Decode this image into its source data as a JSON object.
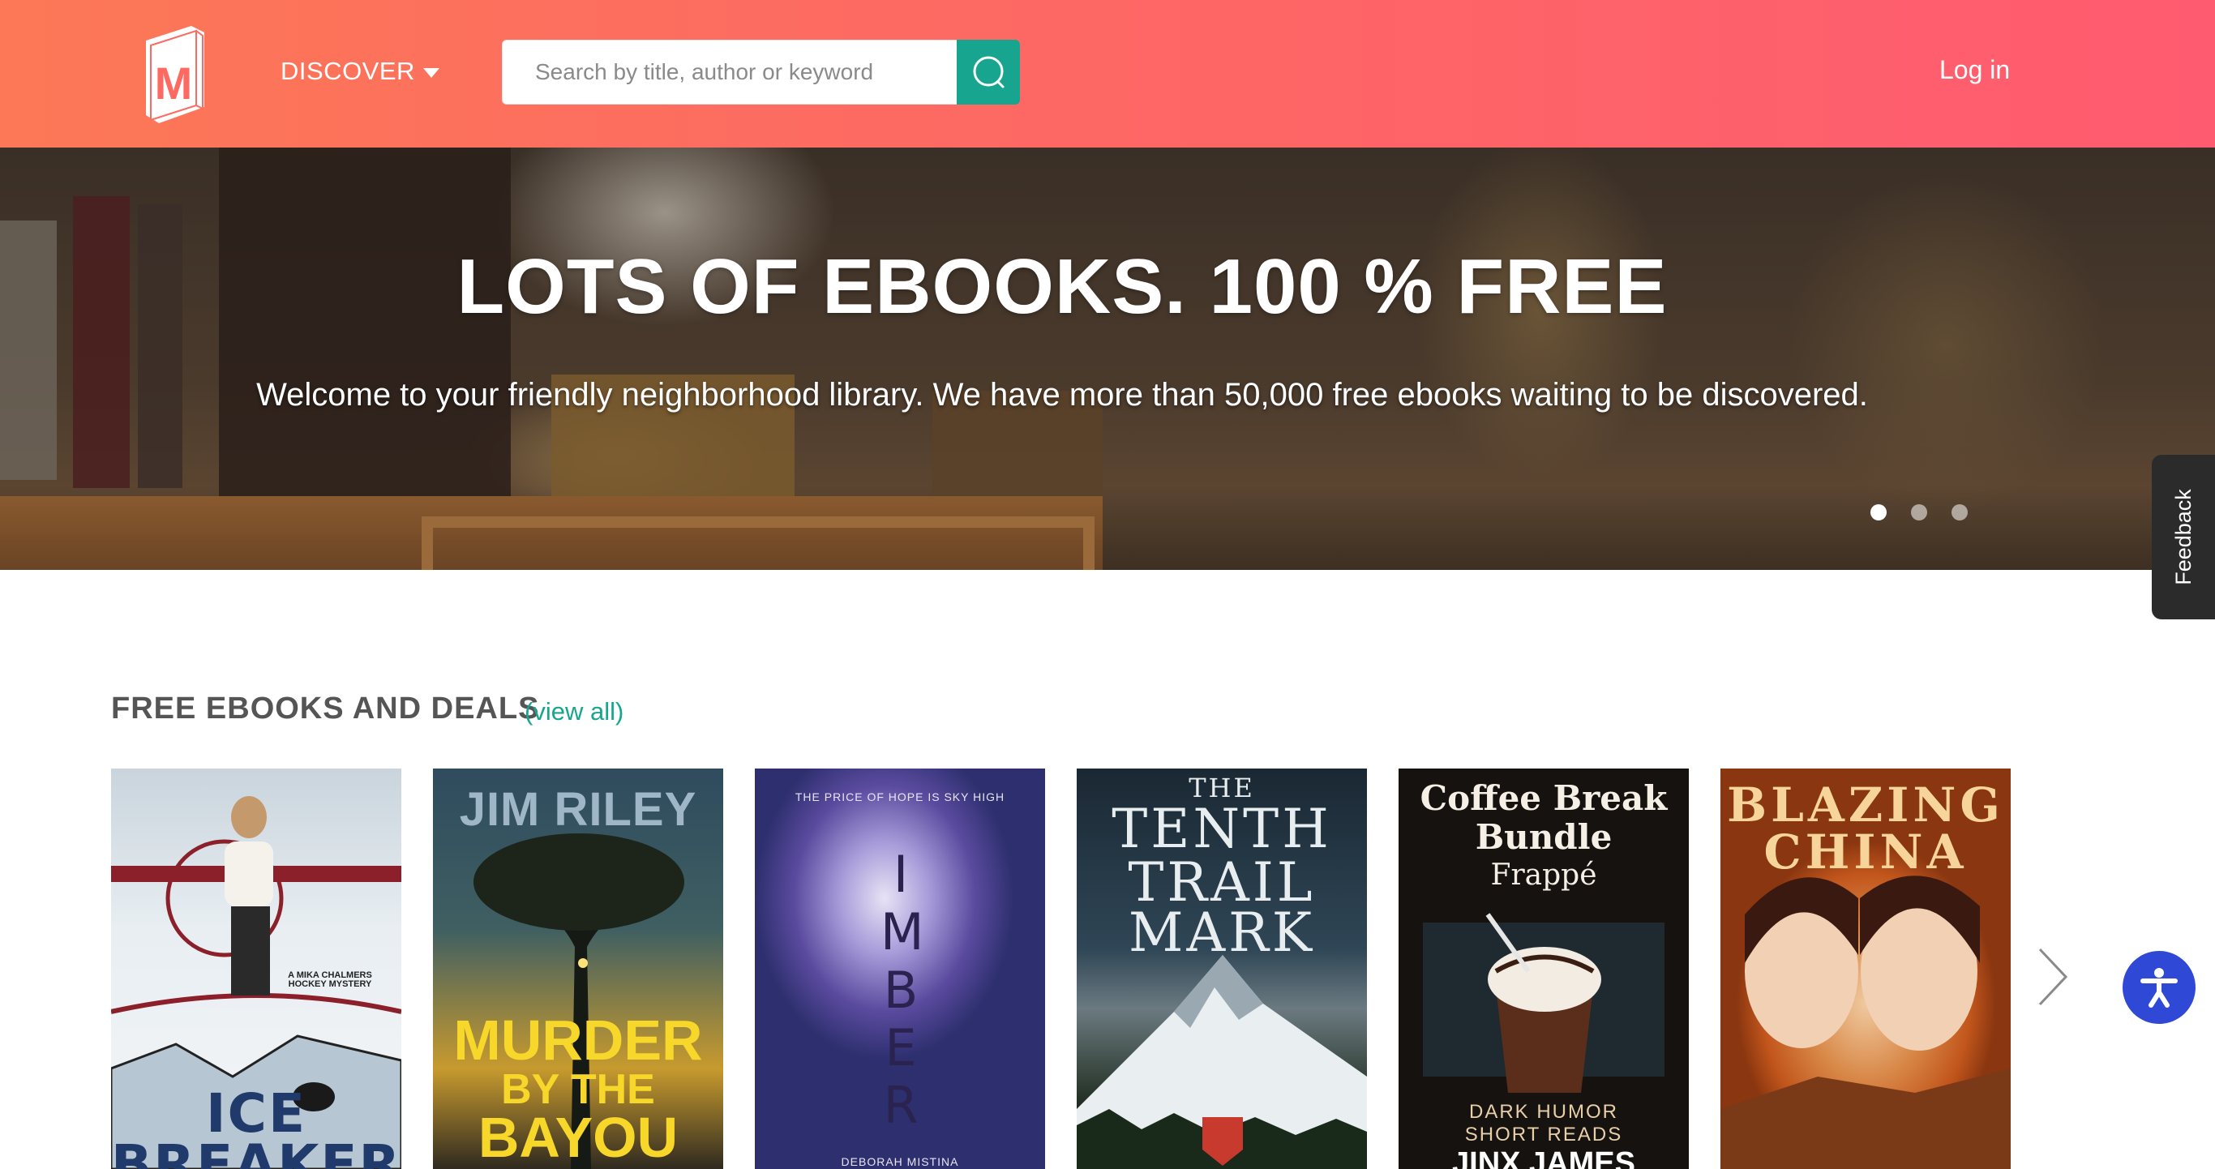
{
  "header": {
    "logo_icon": "book-logo-icon",
    "logo_letter": "M",
    "discover_label": "DISCOVER",
    "search_placeholder": "Search by title, author or keyword",
    "search_icon": "search-icon",
    "login_label": "Log in"
  },
  "hero": {
    "title": "LOTS OF EBOOKS. 100 % FREE",
    "subtitle": "Welcome to your friendly neighborhood library. We have more than 50,000 free ebooks waiting to be discovered.",
    "slides": 3,
    "active_slide": 1
  },
  "feedback_label": "Feedback",
  "section": {
    "title": "FREE EBOOKS AND DEALS",
    "view_all": "(view all)"
  },
  "books": [
    {
      "top_text": "A MIKA CHALMERS HOCKEY MYSTERY",
      "title": "ICE BREAKERS",
      "bg": "#dfe7ee"
    },
    {
      "author": "JIM RILEY",
      "title_lines": [
        "MURDER",
        "BY THE",
        "BAYOU"
      ],
      "bg": "#2e3d3c"
    },
    {
      "tagline": "THE PRICE OF HOPE IS SKY HIGH",
      "title": "IMBER",
      "author": "DEBORAH MISTINA",
      "bg": "#5a4a9e"
    },
    {
      "title_lines": [
        "THE",
        "TENTH",
        "TRAIL",
        "MARK"
      ],
      "bg": "#1c2a33"
    },
    {
      "title_lines": [
        "Coffee Break",
        "Bundle",
        "Frappé"
      ],
      "subtitle_lines": [
        "DARK HUMOR",
        "SHORT READS"
      ],
      "author": "JINX JAMES",
      "bg": "#15120f"
    },
    {
      "title_lines": [
        "BLAZING",
        "CHINA"
      ],
      "bg": "#d2691e"
    }
  ],
  "colors": {
    "header_start": "#fc7856",
    "header_end": "#ff5b70",
    "accent": "#17a58f",
    "accessibility": "#2f49d6"
  },
  "icons": {
    "next": "chevron-right-icon",
    "accessibility": "accessibility-icon"
  }
}
